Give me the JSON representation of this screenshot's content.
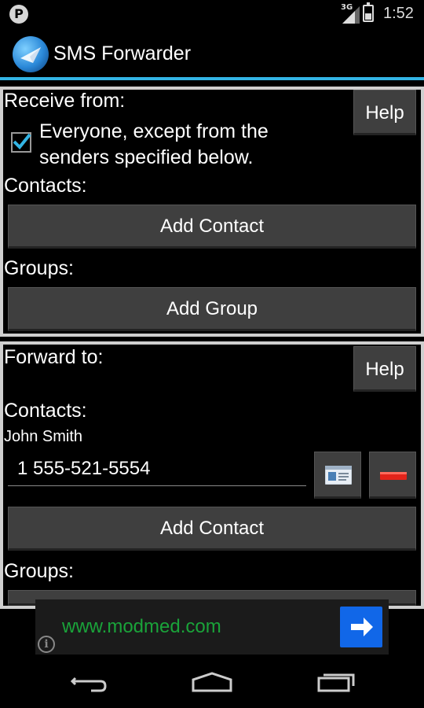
{
  "status_bar": {
    "notification_icon": "P",
    "network_label": "3G",
    "time": "1:52",
    "battery_level": 0.45
  },
  "action_bar": {
    "title": "SMS Forwarder",
    "logo_icon": "sms-forwarder-logo"
  },
  "receive_section": {
    "label": "Receive from:",
    "help_label": "Help",
    "checkbox_checked": true,
    "checkbox_text": "Everyone, except from the senders specified below.",
    "contacts_label": "Contacts:",
    "add_contact_label": "Add Contact",
    "groups_label": "Groups:",
    "add_group_label": "Add Group"
  },
  "forward_section": {
    "label": "Forward to:",
    "help_label": "Help",
    "contacts_label": "Contacts:",
    "contact": {
      "name": "John Smith",
      "phone": "1 555-521-5554"
    },
    "add_contact_label": "Add Contact",
    "groups_label": "Groups:"
  },
  "ad": {
    "text": "www.modmed.com",
    "info_icon": "i",
    "accent": "#1167e8",
    "text_color": "#1aa33a"
  },
  "colors": {
    "holo_blue": "#33b5e5",
    "button_gray": "#3f3f3f"
  }
}
